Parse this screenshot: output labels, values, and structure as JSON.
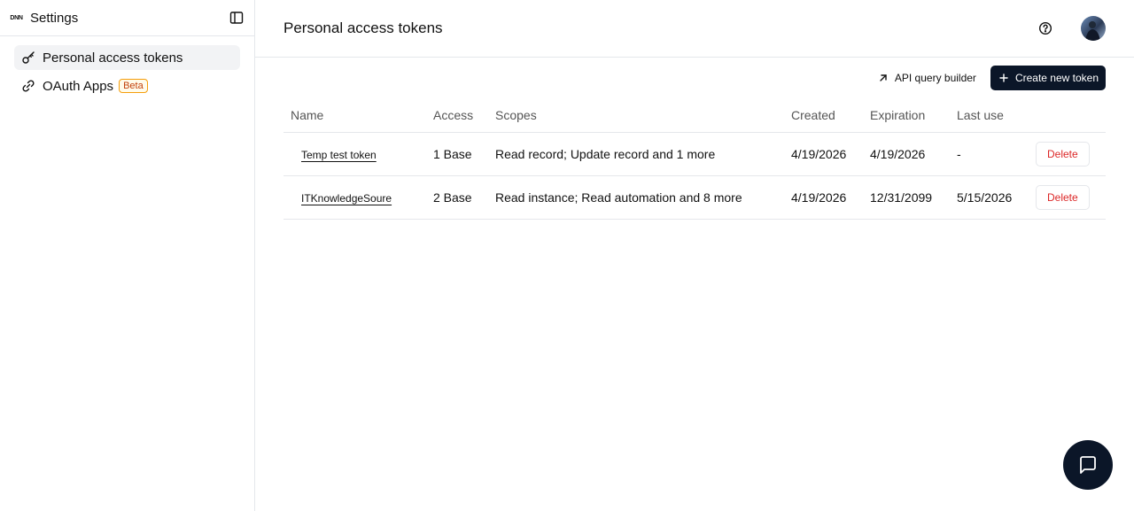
{
  "sidebar": {
    "logo_text": "DNN",
    "title": "Settings",
    "items": [
      {
        "label": "Personal access tokens",
        "icon": "key-icon",
        "active": true
      },
      {
        "label": "OAuth Apps",
        "icon": "link-icon",
        "badge": "Beta"
      }
    ]
  },
  "header": {
    "title": "Personal access tokens"
  },
  "toolbar": {
    "api_label": "API query builder",
    "create_label": "Create new token"
  },
  "table": {
    "columns": [
      "Name",
      "Access",
      "Scopes",
      "Created",
      "Expiration",
      "Last use"
    ],
    "rows": [
      {
        "name": "Temp test token",
        "access": "1 Base",
        "scopes": "Read record; Update record and 1 more",
        "created": "4/19/2026",
        "expiration": "4/19/2026",
        "last_use": "-",
        "action": "Delete"
      },
      {
        "name": "ITKnowledgeSoure",
        "access": "2 Base",
        "scopes": "Read instance; Read automation and 8 more",
        "created": "4/19/2026",
        "expiration": "12/31/2099",
        "last_use": "5/15/2026",
        "action": "Delete"
      }
    ]
  },
  "colors": {
    "primary": "#0b1628",
    "danger": "#dc2626",
    "active_bg": "#f2f3f5",
    "border": "#e5e7eb"
  }
}
